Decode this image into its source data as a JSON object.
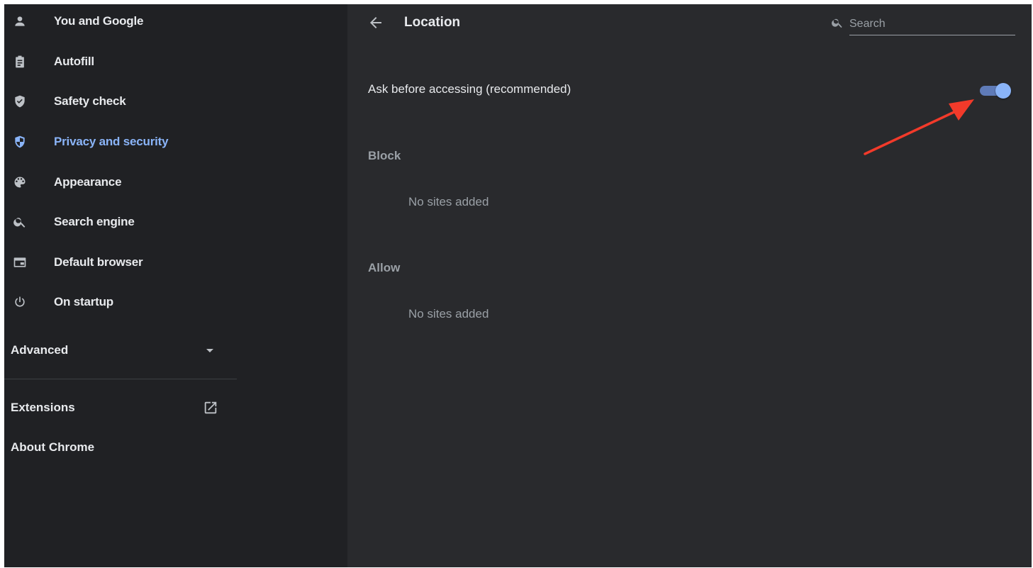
{
  "sidebar": {
    "items": [
      {
        "label": "You and Google",
        "icon": "person-icon"
      },
      {
        "label": "Autofill",
        "icon": "clipboard-icon"
      },
      {
        "label": "Safety check",
        "icon": "shield-check-icon"
      },
      {
        "label": "Privacy and security",
        "icon": "shield-icon",
        "active": true
      },
      {
        "label": "Appearance",
        "icon": "palette-icon"
      },
      {
        "label": "Search engine",
        "icon": "search-icon"
      },
      {
        "label": "Default browser",
        "icon": "browser-icon"
      },
      {
        "label": "On startup",
        "icon": "power-icon"
      }
    ],
    "advanced_label": "Advanced",
    "extensions_label": "Extensions",
    "about_label": "About Chrome"
  },
  "header": {
    "title": "Location",
    "search_placeholder": "Search"
  },
  "content": {
    "ask_label": "Ask before accessing (recommended)",
    "ask_enabled": true,
    "block_heading": "Block",
    "block_empty": "No sites added",
    "allow_heading": "Allow",
    "allow_empty": "No sites added"
  },
  "colors": {
    "sidebar_bg": "#202124",
    "main_bg": "#292a2d",
    "accent": "#8ab4f8",
    "annotation_arrow": "#f23a2a"
  }
}
